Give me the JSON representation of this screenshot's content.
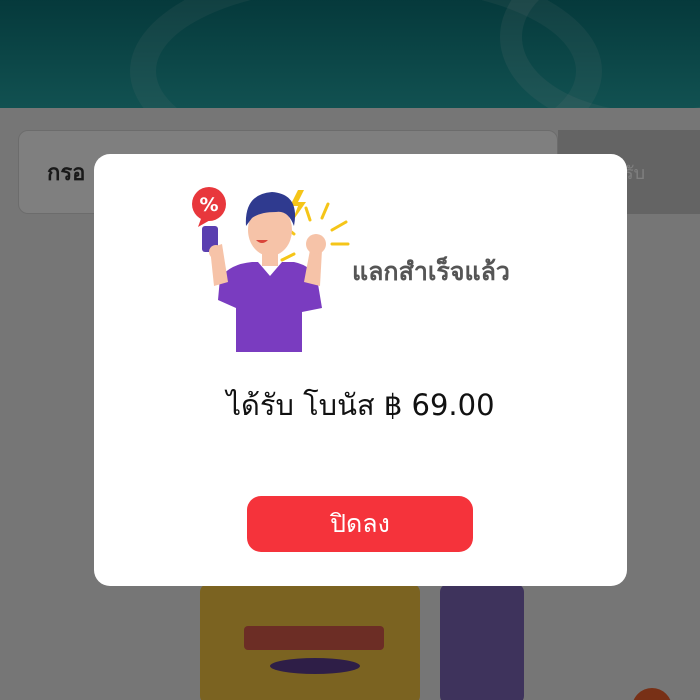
{
  "background": {
    "code_input": {
      "value": "กรอ",
      "placeholder": "กรอกรหัสโค้ด"
    },
    "redeem_button_label": "รับ"
  },
  "modal": {
    "success_title": "แลกสำเร็จแล้ว",
    "bonus": {
      "label": "ได้รับ โบนัส",
      "currency_symbol": "฿",
      "amount": "69.00"
    },
    "close_button_label": "ปิดลง"
  },
  "colors": {
    "header_teal": "#0b7377",
    "close_button_red": "#f5333b",
    "badge_red": "#e8373c",
    "shirt_purple": "#7a3cc0",
    "hair_navy": "#2f3a8f",
    "sparkle_yellow": "#f5c518"
  },
  "icons": {
    "percent_badge": "percent-badge-icon",
    "lightning": "lightning-icon",
    "phone": "phone-icon"
  }
}
